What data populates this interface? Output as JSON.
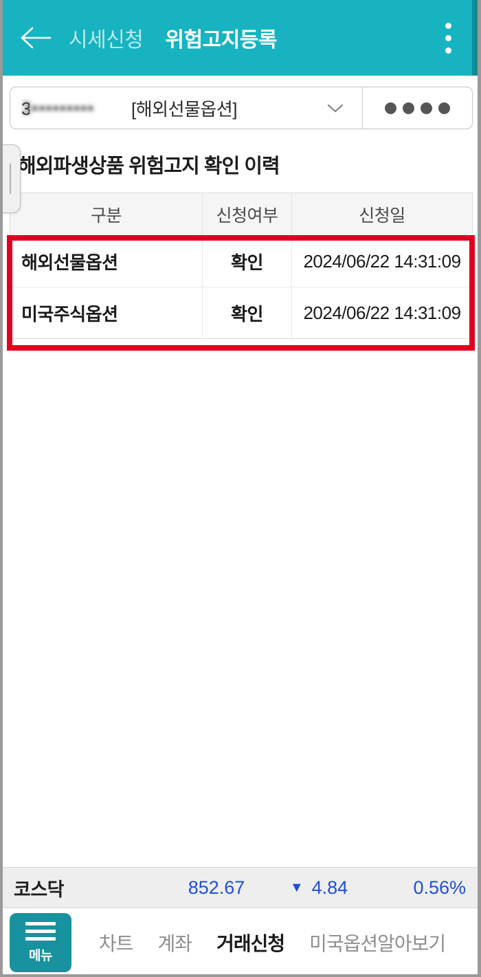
{
  "header": {
    "back_icon": "back-arrow-icon",
    "tabs": [
      {
        "label": "시세신청",
        "active": false
      },
      {
        "label": "위험고지등록",
        "active": true
      }
    ],
    "menu_icon": "kebab-menu-icon",
    "accent_color": "#17b3c0"
  },
  "account": {
    "number_masked": "3•••••••••",
    "number_prefix": "3",
    "product_label": "[해외선물옵션]",
    "chevron_icon": "chevron-down-icon",
    "password_dots": 4,
    "password_icon": "password-dots-icon"
  },
  "drawer": {
    "handle_icon": "drawer-pull-handle-icon"
  },
  "main": {
    "section_title": "해외파생상품 위험고지 확인 이력",
    "table": {
      "headers": [
        "구분",
        "신청여부",
        "신청일"
      ],
      "rows": [
        {
          "category": "해외선물옵션",
          "status": "확인",
          "date": "2024/06/22 14:31:09"
        },
        {
          "category": "미국주식옵션",
          "status": "확인",
          "date": "2024/06/22 14:31:09"
        }
      ],
      "highlight_color": "#e00020"
    }
  },
  "ticker": {
    "name": "코스닥",
    "price": "852.67",
    "direction_icon": "triangle-down-icon",
    "direction_glyph": "▼",
    "change": "4.84",
    "percent": "0.56%",
    "value_color": "#1f4fd8"
  },
  "bottom_nav": {
    "menu_label": "메뉴",
    "menu_icon": "hamburger-menu-icon",
    "menu_color": "#17929e",
    "items": [
      {
        "label": "차트",
        "active": false
      },
      {
        "label": "계좌",
        "active": false
      },
      {
        "label": "거래신청",
        "active": true
      },
      {
        "label": "미국옵션알아보기",
        "active": false
      }
    ]
  }
}
